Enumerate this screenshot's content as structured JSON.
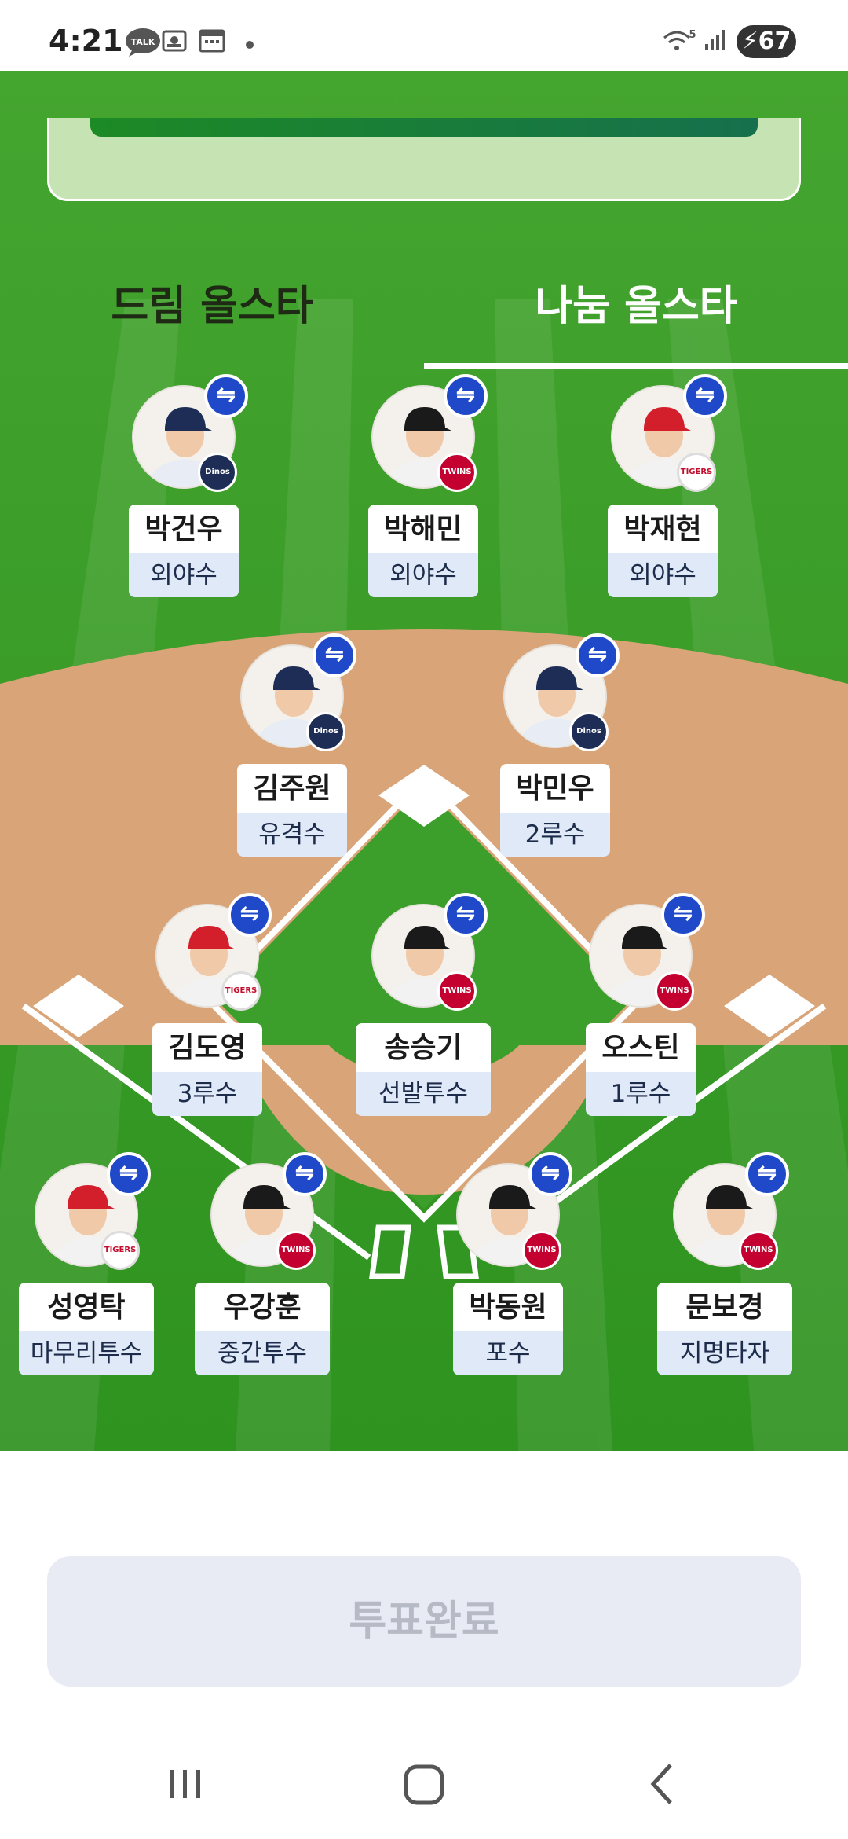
{
  "status_bar": {
    "time": "4:21",
    "talk_label": "TALK",
    "wifi_label": "5",
    "battery_level": "67"
  },
  "colors": {
    "grass": "#3b9f2a",
    "dirt": "#d9a578",
    "swap_badge": "#1f49c9",
    "name_tag_pos_bg": "#dfe9f8"
  },
  "tabs": {
    "dream": "드림 올스타",
    "nanum": "나눔 올스타",
    "selected": "nanum"
  },
  "players": [
    {
      "name": "박건우",
      "position": "외야수",
      "team": "dinos",
      "team_label": "Dinos"
    },
    {
      "name": "박해민",
      "position": "외야수",
      "team": "twins",
      "team_label": "TWINS"
    },
    {
      "name": "박재현",
      "position": "외야수",
      "team": "tigers",
      "team_label": "TIGERS"
    },
    {
      "name": "김주원",
      "position": "유격수",
      "team": "dinos",
      "team_label": "Dinos"
    },
    {
      "name": "박민우",
      "position": "2루수",
      "team": "dinos",
      "team_label": "Dinos"
    },
    {
      "name": "김도영",
      "position": "3루수",
      "team": "tigers",
      "team_label": "TIGERS"
    },
    {
      "name": "송승기",
      "position": "선발투수",
      "team": "twins",
      "team_label": "TWINS"
    },
    {
      "name": "오스틴",
      "position": "1루수",
      "team": "twins",
      "team_label": "TWINS"
    },
    {
      "name": "성영탁",
      "position": "마무리투수",
      "team": "tigers",
      "team_label": "TIGERS"
    },
    {
      "name": "우강훈",
      "position": "중간투수",
      "team": "twins",
      "team_label": "TWINS"
    },
    {
      "name": "박동원",
      "position": "포수",
      "team": "twins",
      "team_label": "TWINS"
    },
    {
      "name": "문보경",
      "position": "지명타자",
      "team": "twins",
      "team_label": "TWINS"
    }
  ],
  "swap_icon_glyph": "⇋",
  "vote_button": {
    "label": "투표완료",
    "state": "disabled"
  },
  "nav": {
    "recents": "recent-apps",
    "home": "home",
    "back": "back"
  }
}
